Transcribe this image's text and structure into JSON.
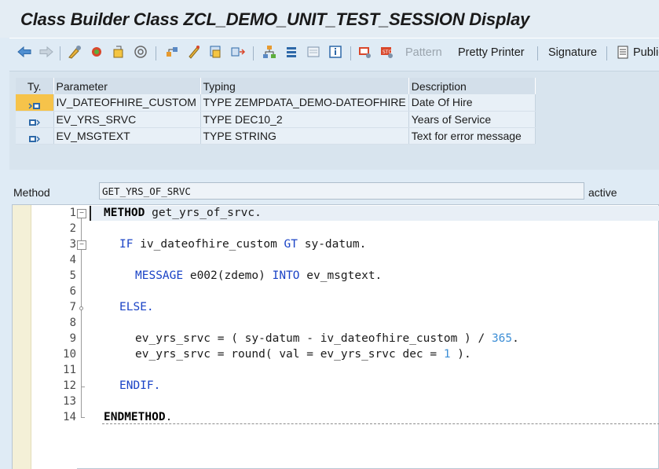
{
  "window": {
    "title": "Class Builder Class ZCL_DEMO_UNIT_TEST_SESSION Display"
  },
  "toolbar": {
    "icons": [
      "back-arrow-icon",
      "forward-arrow-icon",
      "display-change-icon",
      "activate-icon",
      "other-object-icon",
      "where-used-icon",
      "object-list-icon",
      "pencil-icon",
      "navigation-window-icon",
      "display-object-list-icon",
      "hierarchy-icon",
      "stack-icon",
      "frame-icon",
      "info-icon",
      "help-settings-icon",
      "stop-icon"
    ],
    "pattern_label": "Pattern",
    "pretty_printer_label": "Pretty Printer",
    "signature_label": "Signature",
    "public_label": "Public"
  },
  "params": {
    "headers": {
      "ty": "Ty.",
      "parameter": "Parameter",
      "typing": "Typing",
      "description": "Description"
    },
    "rows": [
      {
        "parameter": "IV_DATEOFHIRE_CUSTOM",
        "typing": "TYPE ZEMPDATA_DEMO-DATEOFHIRE",
        "description": "Date Of Hire",
        "kind": "importing"
      },
      {
        "parameter": "EV_YRS_SRVC",
        "typing": "TYPE DEC10_2",
        "description": "Years of Service",
        "kind": "exporting"
      },
      {
        "parameter": "EV_MSGTEXT",
        "typing": "TYPE STRING",
        "description": "Text for error message",
        "kind": "exporting"
      }
    ]
  },
  "method": {
    "label": "Method",
    "name": "GET_YRS_OF_SRVC",
    "status": "active"
  },
  "editor": {
    "line_numbers": [
      "1",
      "2",
      "3",
      "4",
      "5",
      "6",
      "7",
      "8",
      "9",
      "10",
      "11",
      "12",
      "13",
      "14"
    ],
    "lines": {
      "l1": {
        "kw": "METHOD",
        "rest": " get_yrs_of_srvc."
      },
      "l3": {
        "kw": "IF",
        "a": " iv_dateofhire_custom ",
        "kw2": "GT",
        "b": " sy-datum."
      },
      "l5": {
        "kw": "MESSAGE",
        "a": " e002(zdemo) ",
        "kw2": "INTO",
        "b": " ev_msgtext."
      },
      "l7": {
        "kw": "ELSE."
      },
      "l9": {
        "a": "ev_yrs_srvc = ( sy-datum - iv_dateofhire_custom ) / ",
        "num": "365",
        "b": "."
      },
      "l10": {
        "a": "ev_yrs_srvc = round( val = ev_yrs_srvc dec = ",
        "num": "1",
        "b": " )."
      },
      "l12": {
        "kw": "ENDIF."
      },
      "l14": {
        "kw": "ENDMETHOD",
        "rest": "."
      }
    }
  },
  "colors": {
    "accent": "#1a43c6",
    "number": "#3e8fd6",
    "selection": "#f6c34a",
    "background": "#dfebf5"
  }
}
